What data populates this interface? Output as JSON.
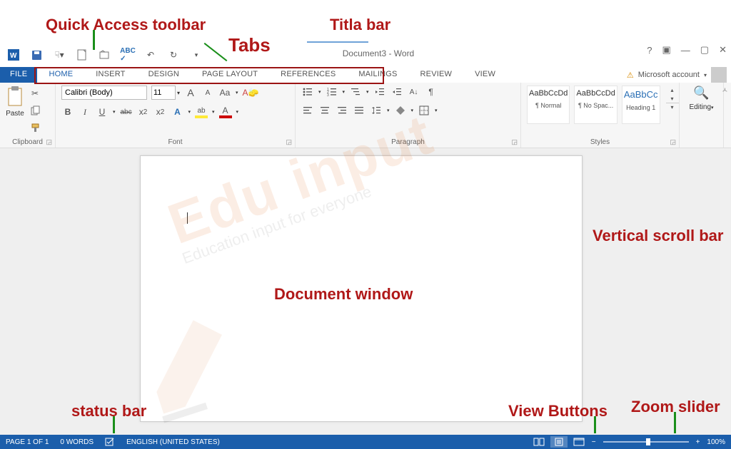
{
  "annotations": {
    "qat": "Quick Access toolbar",
    "titlebar": "Titla bar",
    "tabs": "Tabs",
    "docwin": "Document window",
    "vscroll": "Vertical scroll bar",
    "statusbar": "status bar",
    "viewbtns": "View Buttons",
    "zoom": "Zoom slider"
  },
  "title": "Document3 - Word",
  "account": {
    "label": "Microsoft account"
  },
  "tabs": {
    "file": "FILE",
    "items": [
      "HOME",
      "INSERT",
      "DESIGN",
      "PAGE LAYOUT",
      "REFERENCES",
      "MAILINGS",
      "REVIEW",
      "VIEW"
    ],
    "active": "HOME"
  },
  "ribbon": {
    "clipboard": {
      "label": "Clipboard",
      "paste": "Paste"
    },
    "font": {
      "label": "Font",
      "name": "Calibri (Body)",
      "size": "11",
      "grow": "A",
      "shrink": "A",
      "case": "Aa",
      "clear": "A",
      "bold": "B",
      "italic": "I",
      "underline": "U",
      "strike": "abc",
      "sub": "x",
      "sub2": "2",
      "sup": "x",
      "sup2": "2",
      "effects": "A",
      "highlight": "ab",
      "color": "A"
    },
    "paragraph": {
      "label": "Paragraph"
    },
    "styles": {
      "label": "Styles",
      "items": [
        {
          "preview": "AaBbCcDd",
          "name": "¶ Normal"
        },
        {
          "preview": "AaBbCcDd",
          "name": "¶ No Spac..."
        },
        {
          "preview": "AaBbCc",
          "name": "Heading 1"
        }
      ]
    },
    "editing": {
      "label": "Editing"
    }
  },
  "status": {
    "page": "PAGE 1 OF 1",
    "words": "0 WORDS",
    "lang": "ENGLISH (UNITED STATES)",
    "zoom": "100%",
    "minus": "−",
    "plus": "+"
  },
  "watermark": {
    "main": "Edu input",
    "sub": "Education input for everyone"
  }
}
